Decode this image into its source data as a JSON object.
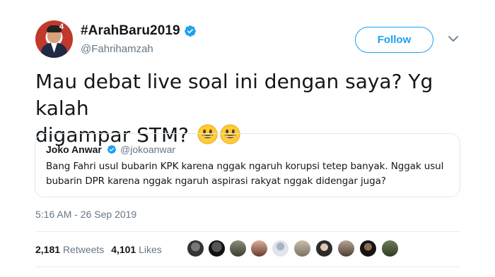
{
  "author": {
    "name": "#ArahBaru2019",
    "handle": "@Fahrihamzah",
    "avatar_badge": "4"
  },
  "follow_button": {
    "label": "Follow"
  },
  "tweet": {
    "text_line1": "Mau debat live soal ini dengan saya? Yg kalah",
    "text_line2": "digampar STM?",
    "emoji": [
      "grinning-face-emoji",
      "grinning-face-emoji"
    ]
  },
  "quoted_tweet": {
    "name": "Joko Anwar",
    "handle": "@jokoanwar",
    "text_line1": "Bang Fahri usul bubarin KPK karena nggak ngaruh korupsi tetep banyak. Nggak usul",
    "text_line2": "bubarin DPR karena nggak ngaruh aspirasi rakyat nggak didengar juga?"
  },
  "timestamp": "5:16 AM - 26 Sep 2019",
  "stats": {
    "retweets_count": "2,181",
    "retweets_label": "Retweets",
    "likes_count": "4,101",
    "likes_label": "Likes"
  },
  "colors": {
    "accent": "#1da1f2",
    "secondary_text": "#657786",
    "divider": "#e6ecf0"
  },
  "likers": [
    "avatar-1",
    "avatar-2",
    "avatar-3",
    "avatar-4",
    "avatar-5",
    "avatar-6",
    "avatar-7",
    "avatar-8",
    "avatar-9",
    "avatar-10"
  ]
}
